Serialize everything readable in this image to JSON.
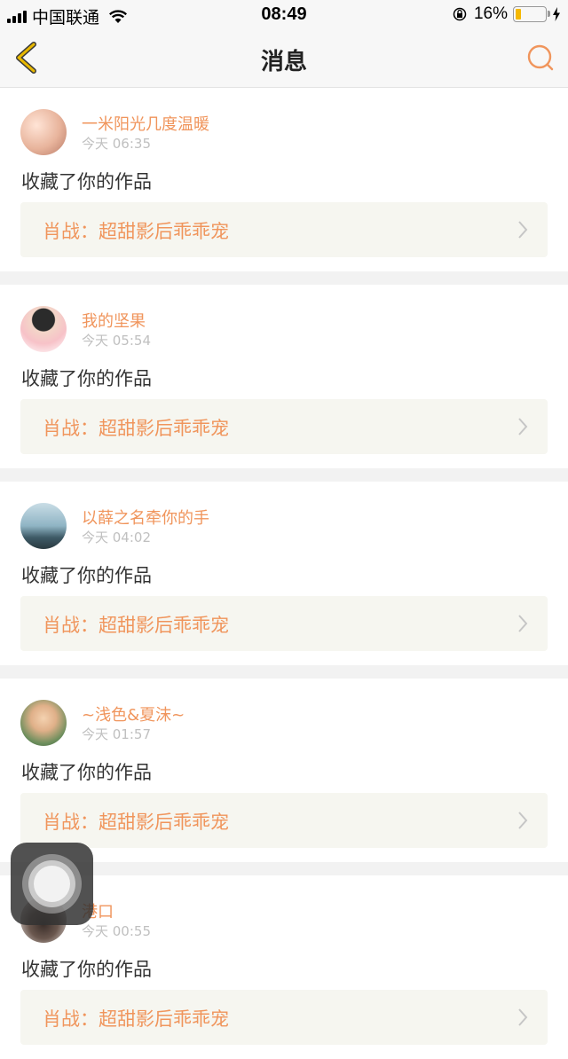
{
  "status_bar": {
    "carrier": "中国联通",
    "time": "08:49",
    "battery": "16%",
    "battery_level": 0.16
  },
  "header": {
    "title": "消息"
  },
  "messages": [
    {
      "user": "一米阳光几度温暖",
      "time": "今天 06:35",
      "action": "收藏了你的作品",
      "work": "肖战：超甜影后乖乖宠"
    },
    {
      "user": "我的坚果",
      "time": "今天 05:54",
      "action": "收藏了你的作品",
      "work": "肖战：超甜影后乖乖宠"
    },
    {
      "user": "以薛之名牵你的手",
      "time": "今天 04:02",
      "action": "收藏了你的作品",
      "work": "肖战：超甜影后乖乖宠"
    },
    {
      "user": "~浅色&夏沫~",
      "time": "今天 01:57",
      "action": "收藏了你的作品",
      "work": "肖战：超甜影后乖乖宠"
    },
    {
      "user": "港口",
      "time": "今天 00:55",
      "action": "收藏了你的作品",
      "work": "肖战：超甜影后乖乖宠"
    }
  ],
  "colors": {
    "accent": "#f0955c",
    "work_box": "#f6f6f0",
    "back_arrow": "#e8b800"
  }
}
